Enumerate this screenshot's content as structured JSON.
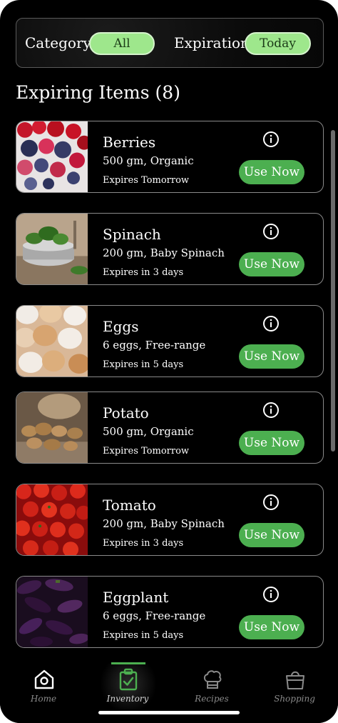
{
  "filters": {
    "category_label": "Category",
    "category_value": "All",
    "expiration_label": "Expiration",
    "expiration_value": "Today"
  },
  "section_title": "Expiring Items (8)",
  "items": [
    {
      "name": "Berries",
      "detail": "500 gm, Organic",
      "expires": "Expires Tomorrow",
      "action": "Use Now",
      "image": "berries"
    },
    {
      "name": "Spinach",
      "detail": "200 gm, Baby Spinach",
      "expires": "Expires in 3 days",
      "action": "Use Now",
      "image": "spinach"
    },
    {
      "name": "Eggs",
      "detail": "6 eggs, Free-range",
      "expires": "Expires in 5 days",
      "action": "Use Now",
      "image": "eggs"
    },
    {
      "name": "Potato",
      "detail": "500 gm, Organic",
      "expires": "Expires Tomorrow",
      "action": "Use Now",
      "image": "potato"
    },
    {
      "name": "Tomato",
      "detail": "200 gm, Baby Spinach",
      "expires": "Expires in 3 days",
      "action": "Use Now",
      "image": "tomato"
    },
    {
      "name": "Eggplant",
      "detail": "6 eggs, Free-range",
      "expires": "Expires in 5 days",
      "action": "Use Now",
      "image": "eggplant"
    }
  ],
  "tabs": [
    {
      "label": "Home",
      "icon": "home-icon"
    },
    {
      "label": "Inventory",
      "icon": "clipboard-check-icon",
      "active": true
    },
    {
      "label": "Recipes",
      "icon": "chef-hat-icon"
    },
    {
      "label": "Shopping",
      "icon": "shopping-bag-icon"
    }
  ],
  "colors": {
    "accent_green": "#4caf50",
    "pill_green": "#9ee78c",
    "background": "#000000"
  }
}
